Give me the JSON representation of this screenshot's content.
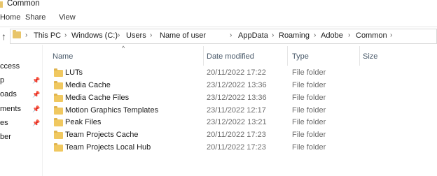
{
  "window": {
    "title": "Common"
  },
  "ribbon": {
    "tabs": [
      "Home",
      "Share",
      "View"
    ]
  },
  "address": {
    "crumbs": [
      "This PC",
      "Windows (C:)",
      "Users",
      "Name of user",
      "AppData",
      "Roaming",
      "Adobe",
      "Common"
    ]
  },
  "nav": {
    "items": [
      "ccess",
      "p",
      "oads",
      "ments",
      "es",
      "ber"
    ]
  },
  "columns": {
    "name": "Name",
    "date": "Date modified",
    "type": "Type",
    "size": "Size"
  },
  "files": [
    {
      "name": "LUTs",
      "date": "20/11/2022 17:22",
      "type": "File folder"
    },
    {
      "name": "Media Cache",
      "date": "23/12/2022 13:36",
      "type": "File folder"
    },
    {
      "name": "Media Cache Files",
      "date": "23/12/2022 13:36",
      "type": "File folder"
    },
    {
      "name": "Motion Graphics Templates",
      "date": "23/11/2022 12:17",
      "type": "File folder"
    },
    {
      "name": "Peak Files",
      "date": "23/12/2022 13:21",
      "type": "File folder"
    },
    {
      "name": "Team Projects Cache",
      "date": "20/11/2022 17:23",
      "type": "File folder"
    },
    {
      "name": "Team Projects Local Hub",
      "date": "20/11/2022 17:23",
      "type": "File folder"
    }
  ],
  "colors": {
    "folder": "#f0c860",
    "header_text": "#4a5a6a",
    "meta_text": "#6d6d6d"
  }
}
